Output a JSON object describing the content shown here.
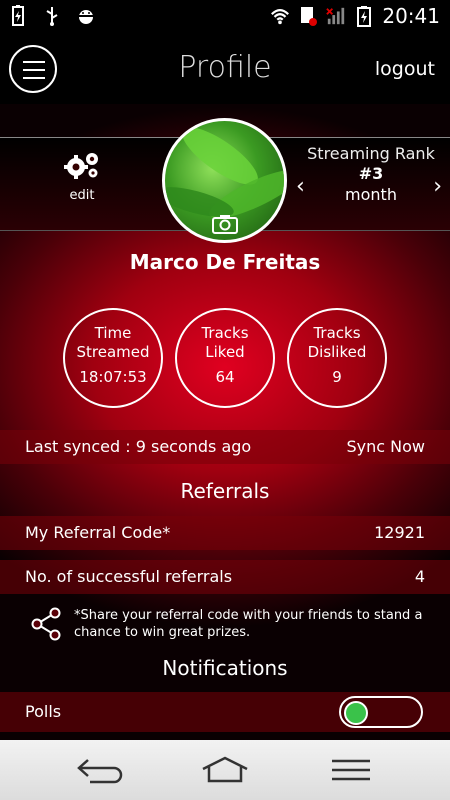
{
  "status": {
    "time": "20:41"
  },
  "header": {
    "title": "Profile",
    "logout_label": "logout"
  },
  "profile": {
    "edit_label": "edit",
    "name": "Marco De Freitas",
    "rank": {
      "title": "Streaming Rank",
      "value": "#3",
      "period": "month"
    }
  },
  "stats": [
    {
      "label_line1": "Time",
      "label_line2": "Streamed",
      "value": "18:07:53"
    },
    {
      "label_line1": "Tracks",
      "label_line2": "Liked",
      "value": "64"
    },
    {
      "label_line1": "Tracks",
      "label_line2": "Disliked",
      "value": "9"
    }
  ],
  "sync": {
    "text": "Last synced : 9 seconds ago",
    "button": "Sync Now"
  },
  "referrals": {
    "title": "Referrals",
    "code_label": "My Referral Code*",
    "code_value": "12921",
    "count_label": "No. of successful referrals",
    "count_value": "4",
    "share_text": "*Share your referral code with your friends to stand a chance to win great prizes."
  },
  "notifications": {
    "title": "Notifications",
    "items": [
      {
        "label": "Polls",
        "enabled": true
      }
    ]
  },
  "colors": {
    "accent": "#e00020",
    "toggle_on": "#3ac24a"
  }
}
